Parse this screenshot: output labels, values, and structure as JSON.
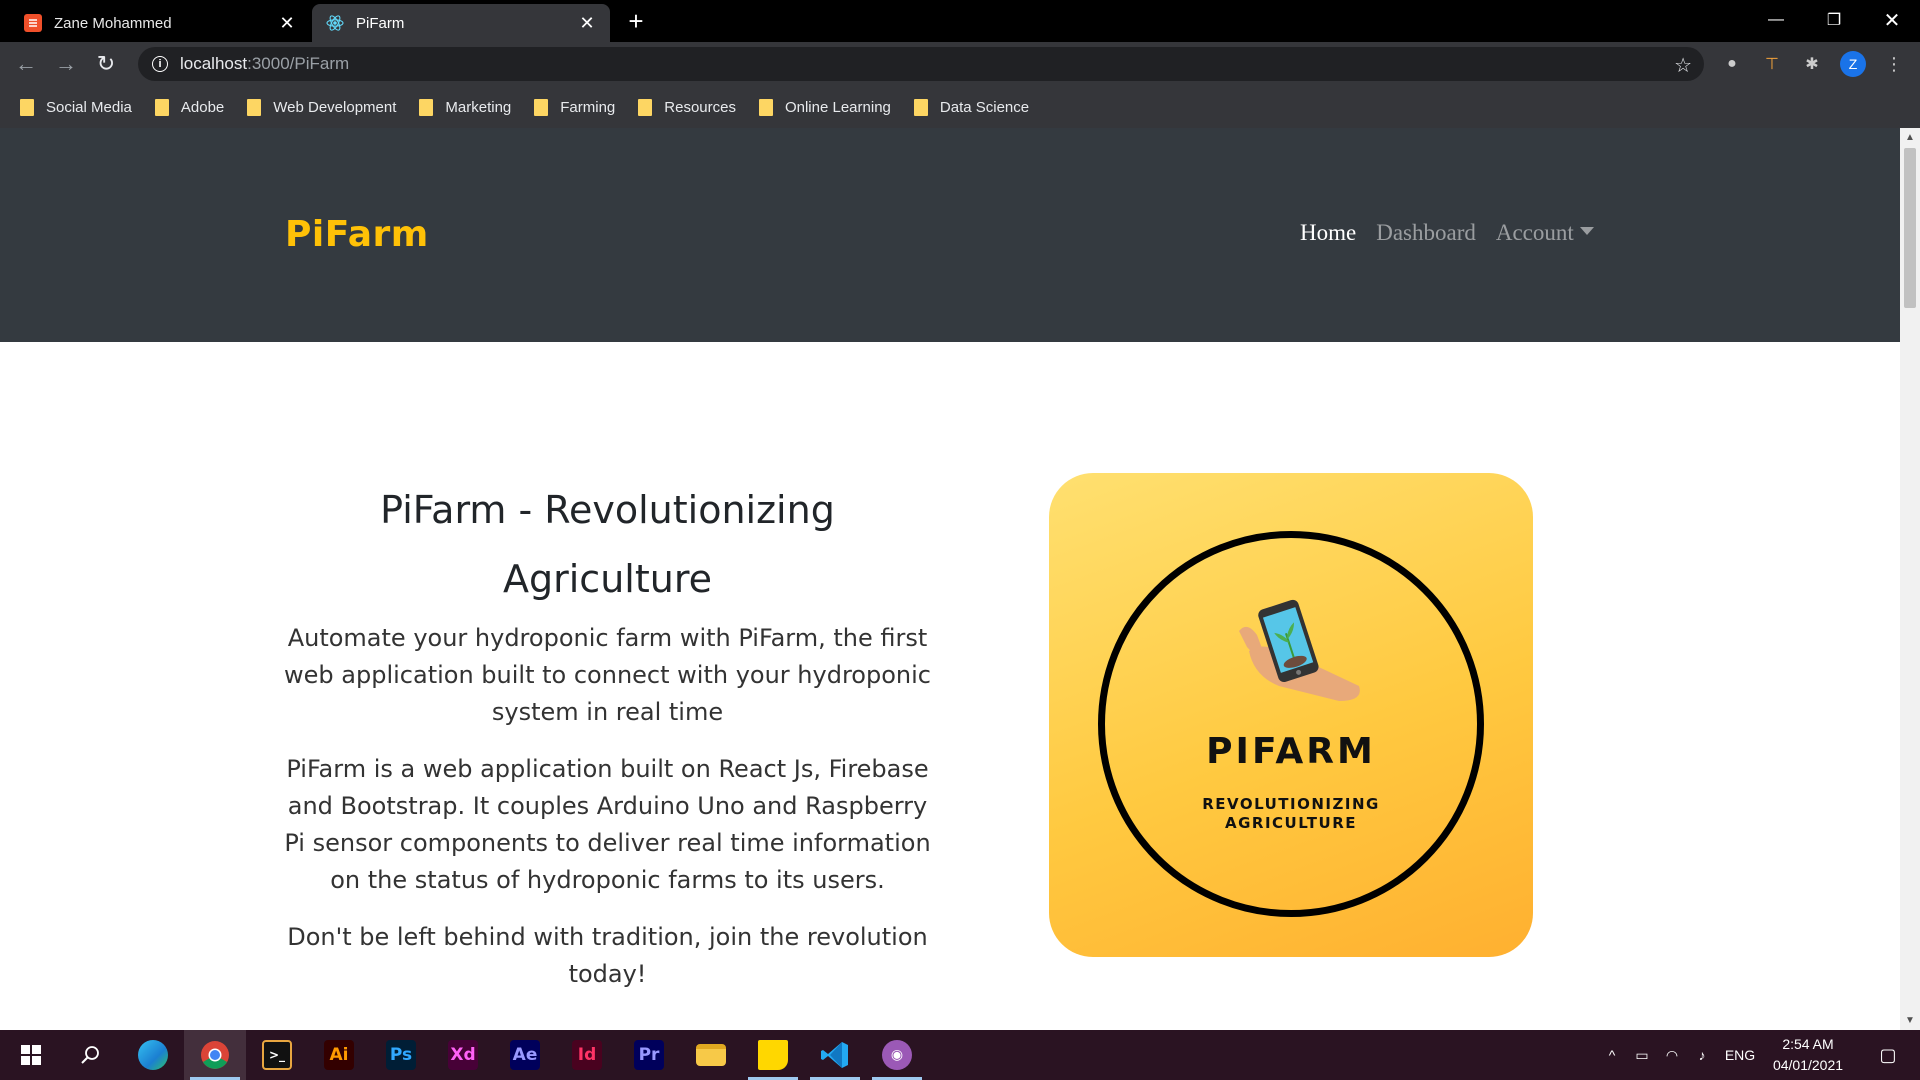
{
  "browser": {
    "tabs": [
      {
        "title": "Zane Mohammed",
        "active": false
      },
      {
        "title": "PiFarm",
        "active": true
      }
    ],
    "new_tab_symbol": "+",
    "close_symbol": "✕",
    "url_host": "localhost",
    "url_path": ":3000/PiFarm",
    "profile_initial": "Z",
    "bookmarks": [
      "Social Media",
      "Adobe",
      "Web Development",
      "Marketing",
      "Farming",
      "Resources",
      "Online Learning",
      "Data Science"
    ]
  },
  "site": {
    "brand": "PiFarm",
    "nav": [
      {
        "label": "Home",
        "active": true
      },
      {
        "label": "Dashboard",
        "active": false
      },
      {
        "label": "Account",
        "active": false,
        "dropdown": true
      }
    ],
    "hero": {
      "title": "PiFarm - Revolutionizing Agriculture",
      "paragraph_1": "Automate your hydroponic farm with PiFarm, the first web application built to connect with your hydroponic system in real time",
      "paragraph_2": "PiFarm is a web application built on React Js, Firebase and Bootstrap. It couples Arduino Uno and Raspberry Pi sensor components to deliver real time information on the status of hydroponic farms to its users.",
      "paragraph_3": "Don't be left behind with tradition, join the revolution today!"
    },
    "logo": {
      "name": "PIFARM",
      "tagline_line1": "REVOLUTIONIZING",
      "tagline_line2": "AGRICULTURE"
    }
  },
  "taskbar": {
    "apps": [
      {
        "name": "edge",
        "label": ""
      },
      {
        "name": "chrome",
        "label": ""
      },
      {
        "name": "terminal",
        "label": ""
      },
      {
        "name": "illustrator",
        "label": "Ai"
      },
      {
        "name": "photoshop",
        "label": "Ps"
      },
      {
        "name": "xd",
        "label": "Xd"
      },
      {
        "name": "after-effects",
        "label": "Ae"
      },
      {
        "name": "indesign",
        "label": "Id"
      },
      {
        "name": "premiere",
        "label": "Pr"
      },
      {
        "name": "file-explorer",
        "label": ""
      },
      {
        "name": "sticky-notes",
        "label": ""
      },
      {
        "name": "vscode",
        "label": ""
      },
      {
        "name": "github-desktop",
        "label": ""
      }
    ],
    "language": "ENG",
    "time": "2:54 AM",
    "date": "04/01/2021"
  },
  "colors": {
    "brand": "#ffc107",
    "navbar": "#343a40",
    "logo_gradient_start": "#ffe070",
    "logo_gradient_end": "#ffb030"
  }
}
